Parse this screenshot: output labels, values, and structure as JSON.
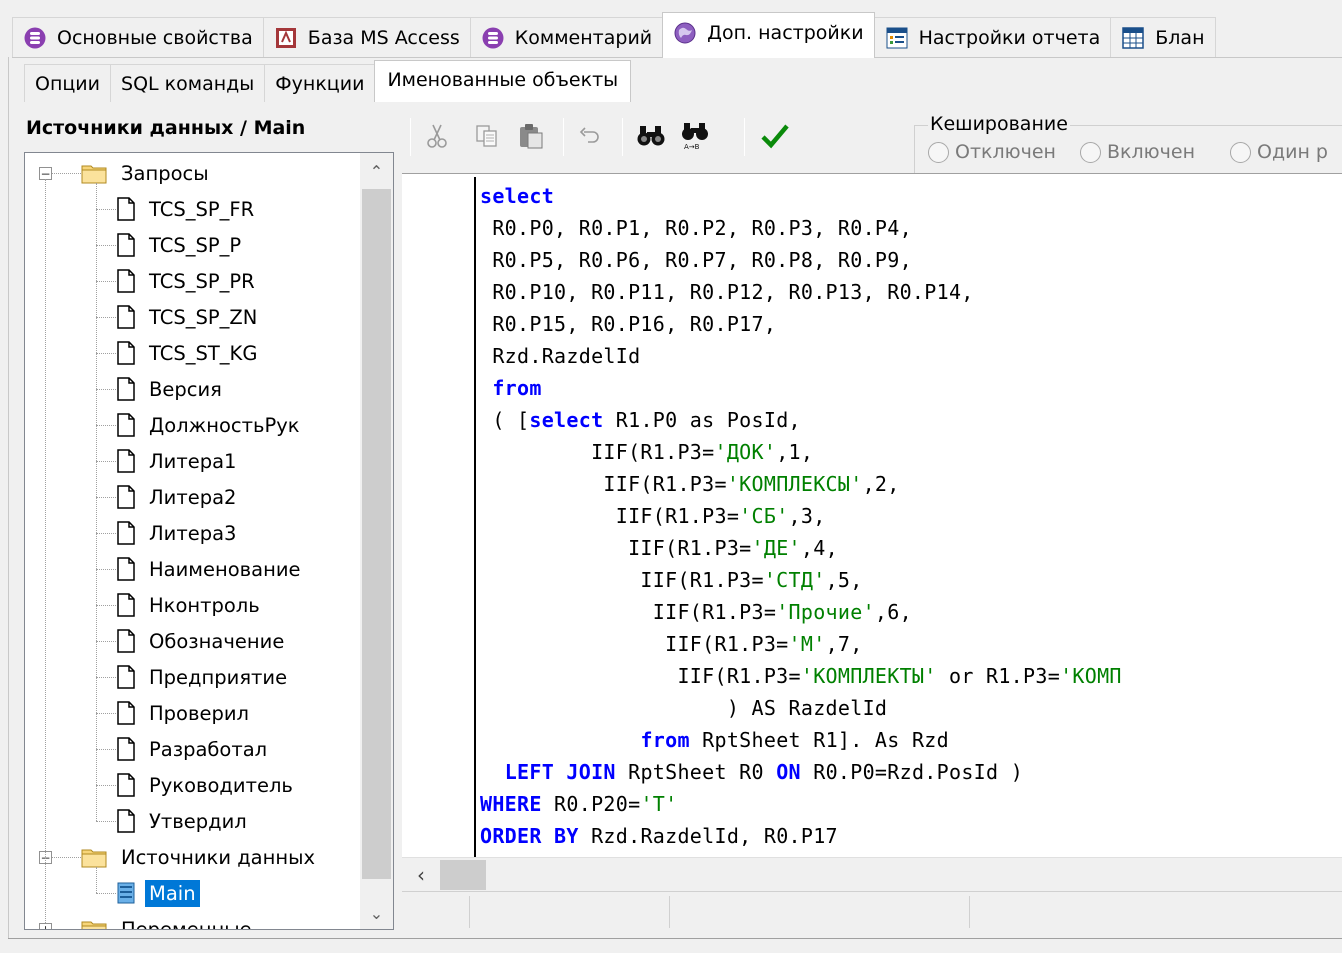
{
  "top_tabs": [
    {
      "label": "Основные свойства",
      "icon": "database-icon",
      "active": false
    },
    {
      "label": "База MS Access",
      "icon": "access-icon",
      "active": false
    },
    {
      "label": "Комментарий",
      "icon": "database-icon",
      "active": false
    },
    {
      "label": "Доп. настройки",
      "icon": "globe-icon",
      "active": true
    },
    {
      "label": "Настройки отчета",
      "icon": "report-settings-icon",
      "active": false
    },
    {
      "label": "Блан",
      "icon": "table-icon",
      "active": false
    }
  ],
  "sub_tabs": [
    {
      "label": "Опции",
      "active": false
    },
    {
      "label": "SQL команды",
      "active": false
    },
    {
      "label": "Функции",
      "active": false
    },
    {
      "label": "Именованные объекты",
      "active": true
    }
  ],
  "left_panel": {
    "title": "Источники данных / Main",
    "tree": {
      "queries_folder": "Запросы",
      "queries": [
        "TCS_SP_FR",
        "TCS_SP_P",
        "TCS_SP_PR",
        "TCS_SP_ZN",
        "TCS_ST_KG",
        "Версия",
        "ДолжностьРук",
        "Литера1",
        "Литера2",
        "Литера3",
        "Наименование",
        "Нконтроль",
        "Обозначение",
        "Предприятие",
        "Проверил",
        "Разработал",
        "Руководитель",
        "Утвердил"
      ],
      "sources_folder": "Источники данных",
      "sources": [
        "Main"
      ],
      "params_folder": "Переменные"
    }
  },
  "toolbar": {
    "buttons": [
      "cut-icon",
      "copy-icon",
      "paste-icon",
      "undo-icon",
      "find-icon",
      "replace-icon",
      "apply-check-icon"
    ]
  },
  "caching": {
    "legend": "Кеширование",
    "options": [
      "Отключен",
      "Включен",
      "Один р"
    ],
    "selected": null
  },
  "editor": {
    "lines": [
      [
        [
          "kw",
          "select"
        ]
      ],
      [
        [
          "plain",
          " R0.P0, R0.P1, R0.P2, R0.P3, R0.P4,"
        ]
      ],
      [
        [
          "plain",
          " R0.P5, R0.P6, R0.P7, R0.P8, R0.P9,"
        ]
      ],
      [
        [
          "plain",
          " R0.P10, R0.P11, R0.P12, R0.P13, R0.P14,"
        ]
      ],
      [
        [
          "plain",
          " R0.P15, R0.P16, R0.P17,"
        ]
      ],
      [
        [
          "plain",
          " Rzd.RazdelId"
        ]
      ],
      [
        [
          "plain",
          " "
        ],
        [
          "kw",
          "from"
        ]
      ],
      [
        [
          "plain",
          " ( ["
        ],
        [
          "kw",
          "select"
        ],
        [
          "plain",
          " R1.P0 as PosId,"
        ]
      ],
      [
        [
          "plain",
          "         IIF(R1.P3="
        ],
        [
          "str",
          "'ДОК'"
        ],
        [
          "plain",
          ",1,"
        ]
      ],
      [
        [
          "plain",
          "          IIF(R1.P3="
        ],
        [
          "str",
          "'КОМПЛЕКСЫ'"
        ],
        [
          "plain",
          ",2,"
        ]
      ],
      [
        [
          "plain",
          "           IIF(R1.P3="
        ],
        [
          "str",
          "'СБ'"
        ],
        [
          "plain",
          ",3,"
        ]
      ],
      [
        [
          "plain",
          "            IIF(R1.P3="
        ],
        [
          "str",
          "'ДЕ'"
        ],
        [
          "plain",
          ",4,"
        ]
      ],
      [
        [
          "plain",
          "             IIF(R1.P3="
        ],
        [
          "str",
          "'СТД'"
        ],
        [
          "plain",
          ",5,"
        ]
      ],
      [
        [
          "plain",
          "              IIF(R1.P3="
        ],
        [
          "str",
          "'Прочие'"
        ],
        [
          "plain",
          ",6,"
        ]
      ],
      [
        [
          "plain",
          "               IIF(R1.P3="
        ],
        [
          "str",
          "'М'"
        ],
        [
          "plain",
          ",7,"
        ]
      ],
      [
        [
          "plain",
          "                IIF(R1.P3="
        ],
        [
          "str",
          "'КОМПЛЕКТЫ'"
        ],
        [
          "plain",
          " or R1.P3="
        ],
        [
          "str",
          "'КОМП"
        ]
      ],
      [
        [
          "plain",
          "                    ) AS RazdelId"
        ]
      ],
      [
        [
          "plain",
          "             "
        ],
        [
          "kw",
          "from"
        ],
        [
          "plain",
          " RptSheet R1]. As Rzd"
        ]
      ],
      [
        [
          "plain",
          "  "
        ],
        [
          "kw",
          "LEFT JOIN"
        ],
        [
          "plain",
          " RptSheet R0 "
        ],
        [
          "kw",
          "ON"
        ],
        [
          "plain",
          " R0.P0=Rzd.PosId )"
        ]
      ],
      [
        [
          "kw",
          "WHERE"
        ],
        [
          "plain",
          " R0.P20="
        ],
        [
          "str",
          "'T'"
        ]
      ],
      [
        [
          "kw",
          "ORDER BY"
        ],
        [
          "plain",
          " Rzd.RazdelId, R0.P17"
        ]
      ]
    ]
  },
  "colors": {
    "keyword": "#0000ff",
    "string": "#008000",
    "selection": "#0078d7"
  }
}
